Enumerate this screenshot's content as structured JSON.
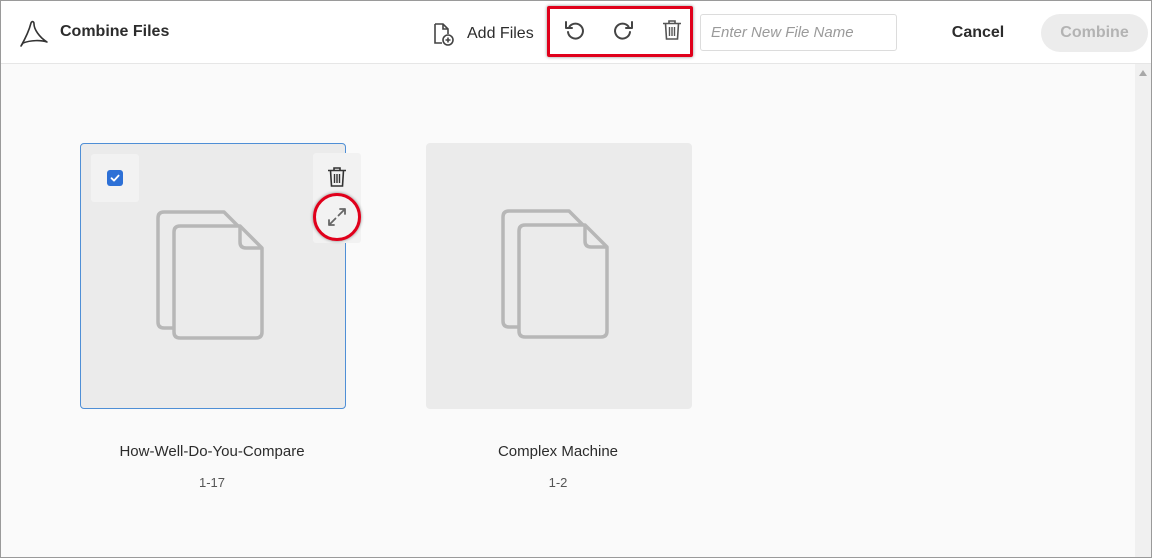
{
  "header": {
    "title": "Combine Files",
    "add_files_label": "Add Files",
    "filename_placeholder": "Enter New File Name",
    "filename_value": "",
    "cancel_label": "Cancel",
    "combine_label": "Combine",
    "toolbar_icons": [
      "undo-icon",
      "redo-icon",
      "trash-icon"
    ]
  },
  "files": [
    {
      "name": "How-Well-Do-You-Compare",
      "pages": "1-17",
      "selected": true
    },
    {
      "name": "Complex Machine",
      "pages": "1-2",
      "selected": false
    }
  ],
  "colors": {
    "accent": "#2d70d6",
    "highlight": "#e0001b",
    "card_bg": "#ebebeb",
    "disabled_bg": "#ececec"
  }
}
